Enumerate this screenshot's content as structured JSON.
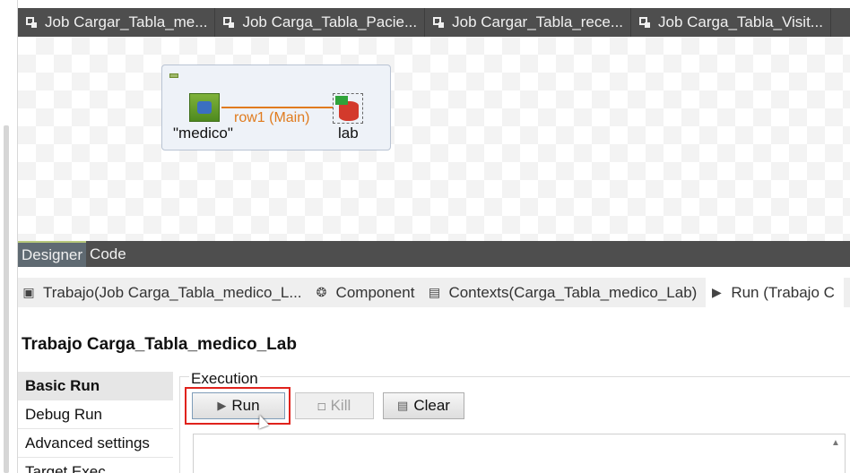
{
  "editor_tabs": [
    {
      "label": "Job Cargar_Tabla_me..."
    },
    {
      "label": "Job Carga_Tabla_Pacie..."
    },
    {
      "label": "Job Cargar_Tabla_rece..."
    },
    {
      "label": "Job Carga_Tabla_Visit..."
    }
  ],
  "designer": {
    "input_component": "\"medico\"",
    "output_component": "lab",
    "connection": "row1 (Main)"
  },
  "designer_tabs": [
    "Designer",
    "Code"
  ],
  "view_tabs": [
    {
      "label": "Trabajo(Job Carga_Tabla_medico_L...",
      "icon": "job-icon"
    },
    {
      "label": "Component",
      "icon": "component-icon"
    },
    {
      "label": "Contexts(Carga_Tabla_medico_Lab)",
      "icon": "contexts-icon"
    },
    {
      "label": "Run (Trabajo C",
      "icon": "run-view-icon"
    }
  ],
  "run_panel": {
    "title": "Trabajo Carga_Tabla_medico_Lab",
    "menu": [
      "Basic Run",
      "Debug Run",
      "Advanced settings",
      "Target Exec"
    ],
    "execution_label": "Execution",
    "buttons": {
      "run": "Run",
      "kill": "Kill",
      "clear": "Clear"
    }
  },
  "colors": {
    "highlight": "#e0221c",
    "connection": "#e07b1e",
    "tab_bar": "#4e4e4e"
  }
}
